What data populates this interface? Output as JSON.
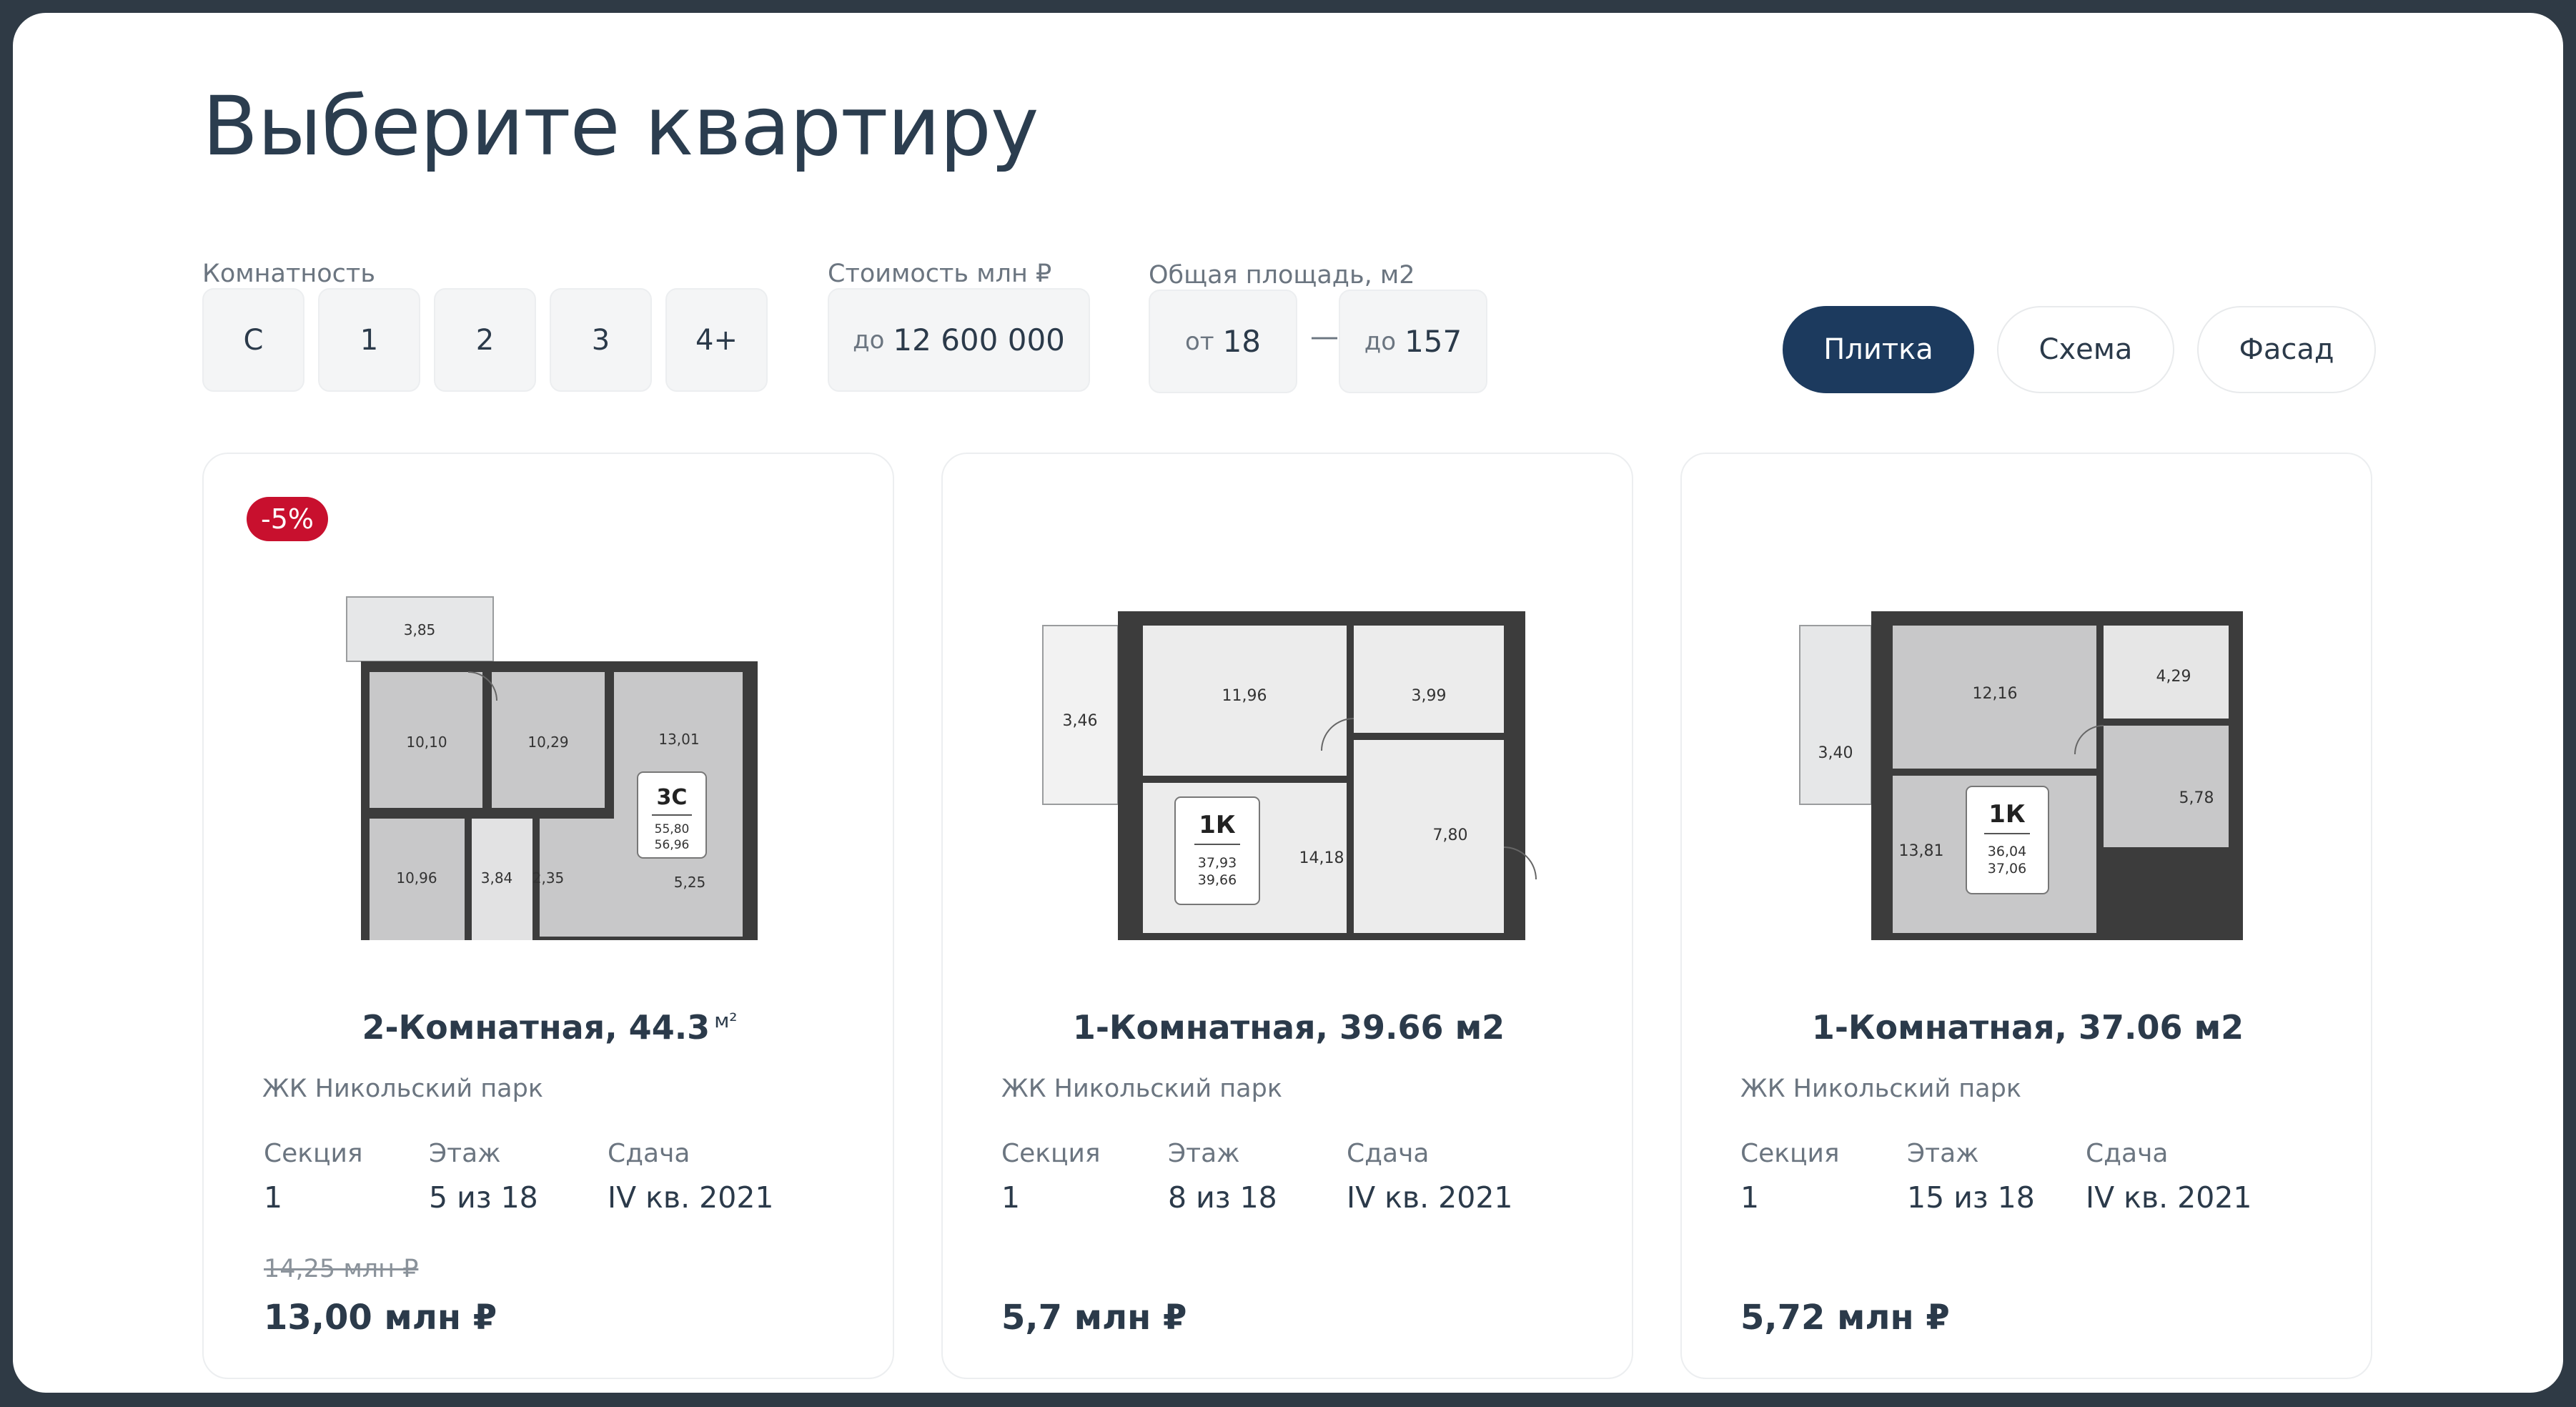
{
  "header": {
    "title": "Выберите квартиру"
  },
  "filters": {
    "rooms": {
      "label": "Комнатность",
      "options": [
        "С",
        "1",
        "2",
        "3",
        "4+"
      ]
    },
    "price": {
      "label": "Стоимость млн ₽",
      "prefix": "до",
      "value": "12 600 000"
    },
    "area": {
      "label": "Общая площадь, м2",
      "from_prefix": "от",
      "from_value": "18",
      "separator": "—",
      "to_prefix": "до",
      "to_value": "157"
    }
  },
  "view_toggle": {
    "options": [
      "Плитка",
      "Схема",
      "Фасад"
    ],
    "active": "Плитка"
  },
  "info_labels": {
    "section": "Секция",
    "floor": "Этаж",
    "delivery": "Сдача"
  },
  "cards": [
    {
      "badge": "-5%",
      "title": "2-Комнатная, 44.3",
      "title_unit": "м²",
      "complex": "ЖК Никольский парк",
      "section": "1",
      "floor": "5 из 18",
      "delivery": "IV кв. 2021",
      "old_price": "14,25 млн ₽",
      "price": "13,00 млн ₽",
      "plan": {
        "badge": "3С",
        "area_living": "55,80",
        "area_total": "56,96",
        "rooms": [
          "3,85",
          "10,10",
          "10,29",
          "13,01",
          "10,96",
          "3,84",
          "2,35",
          "5,25"
        ]
      }
    },
    {
      "title": "1-Комнатная, 39.66 м2",
      "complex": "ЖК Никольский парк",
      "section": "1",
      "floor": "8 из 18",
      "delivery": "IV кв. 2021",
      "price": "5,7 млн ₽",
      "plan": {
        "badge": "1К",
        "area_living": "37,93",
        "area_total": "39,66",
        "rooms": [
          "3,46",
          "11,96",
          "3,99",
          "14,18",
          "7,80"
        ]
      }
    },
    {
      "title": "1-Комнатная, 37.06 м2",
      "complex": "ЖК Никольский парк",
      "section": "1",
      "floor": "15 из 18",
      "delivery": "IV кв. 2021",
      "price": "5,72 млн ₽",
      "plan": {
        "badge": "1К",
        "area_living": "36,04",
        "area_total": "37,06",
        "rooms": [
          "3,40",
          "12,16",
          "4,29",
          "13,81",
          "5,78"
        ]
      }
    }
  ],
  "colors": {
    "accent": "#1c3a5e",
    "discount": "#c8102e",
    "text": "#2b3a4a",
    "muted": "#6b7580"
  }
}
